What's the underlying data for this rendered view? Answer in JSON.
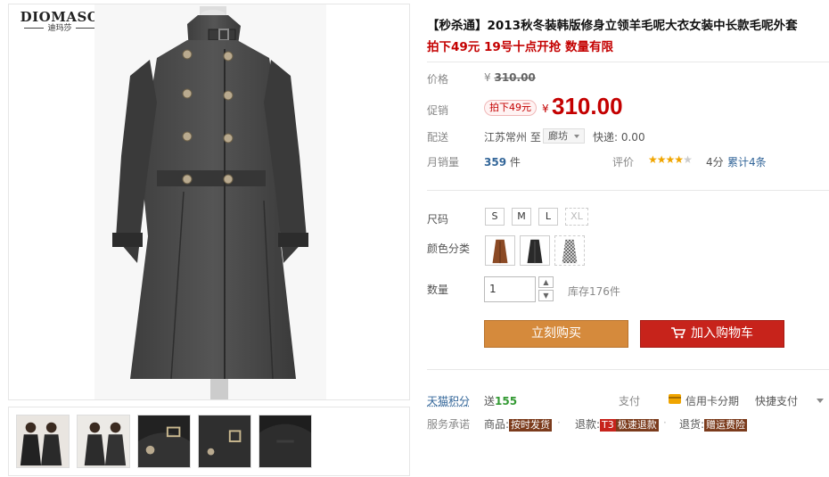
{
  "brand": {
    "name": "DIOMASO",
    "sub": "迪玛莎"
  },
  "product": {
    "title": "【秒杀通】2013秋冬装韩版修身立领羊毛呢大衣女装中长款毛呢外套",
    "subtitle": "拍下49元 19号十点开抢 数量有限"
  },
  "price": {
    "label": "价格",
    "original_yen": "¥",
    "original": "310.00",
    "promo_label": "促销",
    "promo_tag": "拍下49元",
    "yen": "¥",
    "current": "310.00"
  },
  "delivery": {
    "label": "配送",
    "from": "江苏常州 至",
    "to": "廊坊",
    "fee": "快递: 0.00"
  },
  "sales": {
    "label": "月销量",
    "count": "359",
    "unit": "件",
    "rating_label": "评价",
    "stars": 4,
    "score": "4分",
    "reviews": "累计4条"
  },
  "sizes": {
    "label": "尺码",
    "options": [
      "S",
      "M",
      "L",
      "XL"
    ],
    "disabled": [
      "XL"
    ]
  },
  "colors": {
    "label": "颜色分类",
    "swatches": [
      "brown-coat",
      "black-coat",
      "houndstooth-coat"
    ],
    "brown": "#8b4a25",
    "black": "#2a2a2a"
  },
  "quantity": {
    "label": "数量",
    "value": "1",
    "stock": "库存176件"
  },
  "buttons": {
    "buy": "立刻购买",
    "cart": "加入购物车"
  },
  "points": {
    "label": "天猫积分",
    "prefix": "送",
    "value": "155"
  },
  "payment": {
    "label": "支付",
    "credit": "信用卡分期",
    "quick": "快捷支付"
  },
  "service": {
    "label": "服务承诺",
    "goods_prefix": "商品:",
    "goods_tag": "按时发货",
    "refund_prefix": "退款:",
    "refund_tag_a": "T3",
    "refund_tag_b": "极速退款",
    "return_prefix": "退货:",
    "return_tag": "赠运费险"
  },
  "accent_colors": {
    "price": "#c40000",
    "buy": "#d58a3c",
    "cart": "#c7231b",
    "link": "#336699"
  }
}
